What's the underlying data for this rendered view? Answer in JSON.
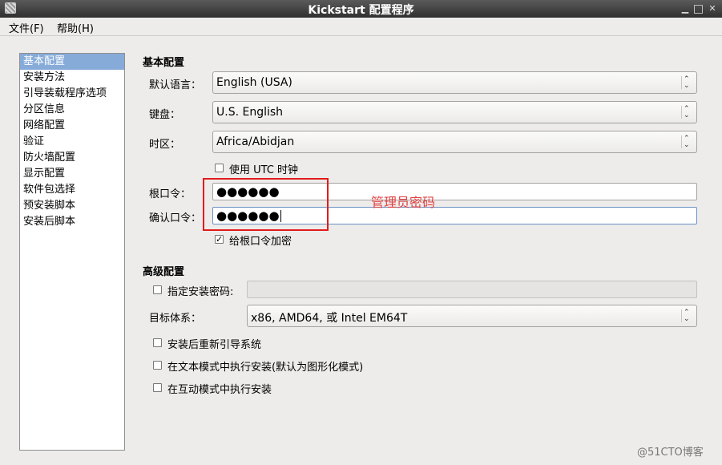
{
  "window": {
    "title": "Kickstart 配置程序"
  },
  "menubar": {
    "file": "文件(F)",
    "help": "帮助(H)"
  },
  "sidebar": {
    "items": [
      {
        "label": "基本配置",
        "selected": true
      },
      {
        "label": "安装方法"
      },
      {
        "label": "引导装载程序选项"
      },
      {
        "label": "分区信息"
      },
      {
        "label": "网络配置"
      },
      {
        "label": "验证"
      },
      {
        "label": "防火墙配置"
      },
      {
        "label": "显示配置"
      },
      {
        "label": "软件包选择"
      },
      {
        "label": "预安装脚本"
      },
      {
        "label": "安装后脚本"
      }
    ]
  },
  "basic": {
    "title": "基本配置",
    "language_label": "默认语言：",
    "language_value": "English (USA)",
    "keyboard_label": "键盘：",
    "keyboard_value": "U.S. English",
    "timezone_label": "时区：",
    "timezone_value": "Africa/Abidjan",
    "utc_label": "使用 UTC 时钟",
    "utc_checked": false,
    "root_pw_label": "根口令：",
    "root_pw_value": "●●●●●●",
    "confirm_pw_label": "确认口令：",
    "confirm_pw_value": "●●●●●●",
    "encrypt_label": "给根口令加密",
    "encrypt_checked": true
  },
  "advanced": {
    "title": "高级配置",
    "install_key_label": "指定安装密码:",
    "install_key_checked": false,
    "install_key_value": "",
    "arch_label": "目标体系：",
    "arch_value": "x86, AMD64, 或 Intel EM64T",
    "reboot_label": "安装后重新引导系统",
    "reboot_checked": false,
    "text_mode_label": "在文本模式中执行安装(默认为图形化模式)",
    "text_mode_checked": false,
    "interactive_label": "在互动模式中执行安装",
    "interactive_checked": false
  },
  "annotation": {
    "text": "管理员密码",
    "color": "#e21b1b"
  },
  "watermark": "@51CTO博客",
  "icons": {
    "combo_arrow": "up-down-chevron-icon",
    "check": "checkmark-icon"
  }
}
